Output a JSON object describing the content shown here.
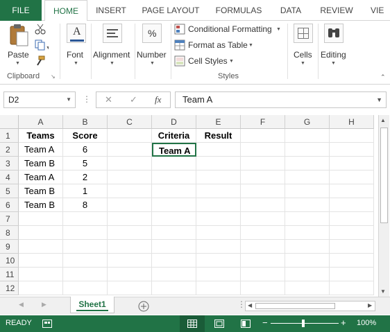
{
  "ribbon_tabs": [
    "FILE",
    "HOME",
    "INSERT",
    "PAGE LAYOUT",
    "FORMULAS",
    "DATA",
    "REVIEW",
    "VIE"
  ],
  "ribbon": {
    "paste_label": "Paste",
    "clipboard_label": "Clipboard",
    "font_label": "Font",
    "alignment_label": "Alignment",
    "number_label": "Number",
    "number_icon": "%",
    "conditional_formatting": "Conditional Formatting",
    "format_as_table": "Format as Table",
    "cell_styles": "Cell Styles",
    "styles_label": "Styles",
    "cells_label": "Cells",
    "editing_label": "Editing"
  },
  "formula_bar": {
    "name_box": "D2",
    "fx": "fx",
    "content": "Team A"
  },
  "columns": [
    "A",
    "B",
    "C",
    "D",
    "E",
    "F",
    "G",
    "H"
  ],
  "rows": [
    "1",
    "2",
    "3",
    "4",
    "5",
    "6",
    "7",
    "8",
    "9",
    "10",
    "11",
    "12"
  ],
  "cells": {
    "A1": "Teams",
    "B1": "Score",
    "D1": "Criteria",
    "E1": "Result",
    "A2": "Team A",
    "B2": "6",
    "D2": "Team A",
    "A3": "Team B",
    "B3": "5",
    "A4": "Team A",
    "B4": "2",
    "A5": "Team B",
    "B5": "1",
    "A6": "Team B",
    "B6": "8"
  },
  "sheet_tab": "Sheet1",
  "status": {
    "ready": "READY",
    "zoom": "100%"
  },
  "colors": {
    "excel_green": "#217346"
  }
}
